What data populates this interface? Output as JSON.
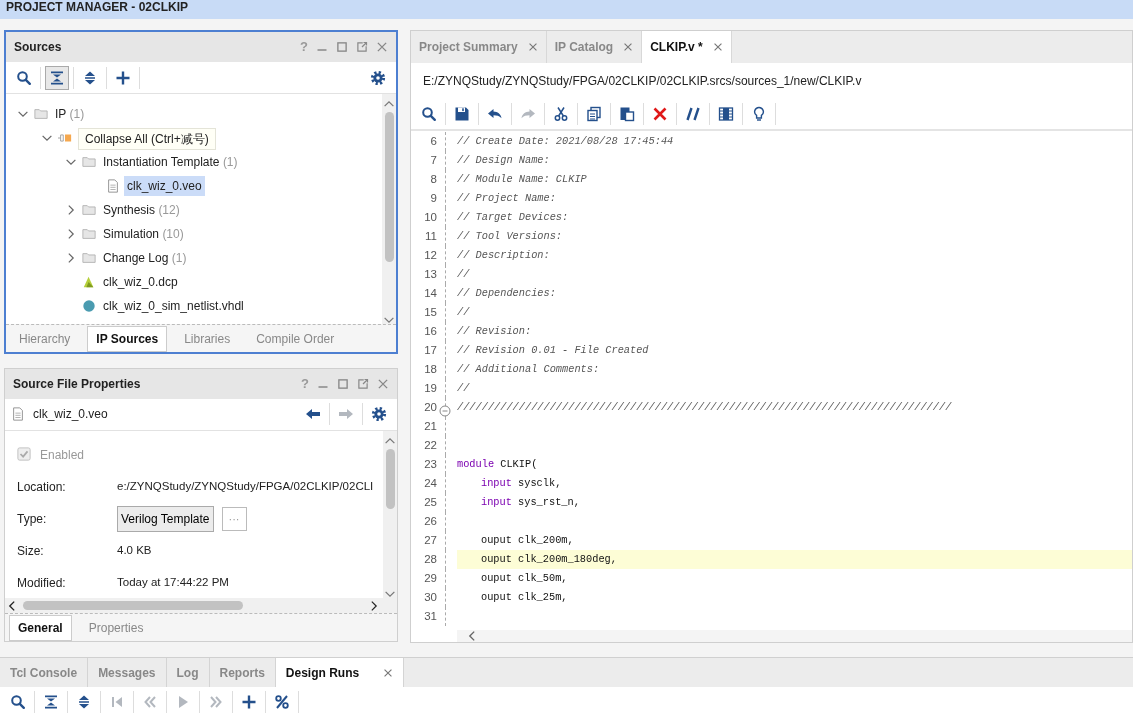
{
  "header": {
    "title": "PROJECT MANAGER - 02CLKIP"
  },
  "sources": {
    "title": "Sources",
    "help": "?",
    "toolbar": [
      {
        "pressed": false
      },
      {
        "pressed": true
      },
      {
        "pressed": false
      },
      {
        "pressed": false
      }
    ],
    "tree": [
      {
        "kind": "folder",
        "label": "IP",
        "count": "(1)",
        "expanded": true,
        "selected": false,
        "children": [
          {
            "kind": "ip",
            "expanded": true,
            "children": [
              {
                "kind": "folder",
                "label": "Instantiation Template",
                "count": "(1)",
                "expanded": true,
                "selected": false,
                "children": [
                  {
                    "kind": "file",
                    "label": "clk_wiz_0.veo",
                    "selected": true
                  }
                ]
              },
              {
                "kind": "folder",
                "label": "Synthesis",
                "count": "(12)",
                "expanded": false,
                "selected": false
              },
              {
                "kind": "folder",
                "label": "Simulation",
                "count": "(10)",
                "expanded": false,
                "selected": false
              },
              {
                "kind": "folder",
                "label": "Change Log",
                "count": "(1)",
                "expanded": false,
                "selected": false
              },
              {
                "kind": "dcp",
                "label": "clk_wiz_0.dcp",
                "selected": false
              },
              {
                "kind": "sim",
                "label": "clk_wiz_0_sim_netlist.vhdl",
                "selected": false
              }
            ]
          }
        ]
      }
    ],
    "tooltip": "Collapse All (Ctrl+减号)",
    "tabs": [
      {
        "label": "Hierarchy",
        "selected": false
      },
      {
        "label": "IP Sources",
        "selected": true
      },
      {
        "label": "Libraries",
        "selected": false
      },
      {
        "label": "Compile Order",
        "selected": false
      }
    ]
  },
  "properties": {
    "title": "Source File Properties",
    "help": "?",
    "file": "clk_wiz_0.veo",
    "nav": [
      {
        "disabled": false
      },
      {
        "disabled": true
      }
    ],
    "enabled": {
      "label": "Enabled",
      "checked": true,
      "disabled": true
    },
    "rows": [
      {
        "kind": "text",
        "label": "Location:",
        "value": "e:/ZYNQStudy/ZYNQStudy/FPGA/02CLKIP/02CLI"
      },
      {
        "kind": "button",
        "label": "Type:",
        "value": "Verilog Template",
        "more": "···"
      },
      {
        "kind": "text",
        "label": "Size:",
        "value": "4.0 KB"
      },
      {
        "kind": "text",
        "label": "Modified:",
        "value": "Today at 17:44:22 PM"
      }
    ],
    "tabs": [
      {
        "label": "General",
        "selected": true
      },
      {
        "label": "Properties",
        "selected": false
      }
    ]
  },
  "editor": {
    "tabs": [
      {
        "label": "Project Summary",
        "selected": false
      },
      {
        "label": "IP Catalog",
        "selected": false
      },
      {
        "label": "CLKIP.v *",
        "selected": true
      }
    ],
    "path": "E:/ZYNQStudy/ZYNQStudy/FPGA/02CLKIP/02CLKIP.srcs/sources_1/new/CLKIP.v",
    "toolbar": [
      {
        "disabled": false
      },
      {
        "disabled": false
      },
      {
        "disabled": false
      },
      {
        "disabled": true
      },
      {
        "disabled": false
      },
      {
        "disabled": false
      },
      {
        "disabled": false
      },
      {
        "disabled": false
      },
      {
        "disabled": false
      },
      {
        "disabled": false
      },
      {
        "disabled": false
      }
    ],
    "lines": [
      {
        "number": "6",
        "kind": "comment",
        "text": "// Create Date: 2021/08/28 17:45:44",
        "current": false,
        "fold": false
      },
      {
        "number": "7",
        "kind": "comment",
        "text": "// Design Name:",
        "current": false,
        "fold": false
      },
      {
        "number": "8",
        "kind": "comment",
        "text": "// Module Name: CLKIP",
        "current": false,
        "fold": false
      },
      {
        "number": "9",
        "kind": "comment",
        "text": "// Project Name:",
        "current": false,
        "fold": false
      },
      {
        "number": "10",
        "kind": "comment",
        "text": "// Target Devices:",
        "current": false,
        "fold": false
      },
      {
        "number": "11",
        "kind": "comment",
        "text": "// Tool Versions:",
        "current": false,
        "fold": false
      },
      {
        "number": "12",
        "kind": "comment",
        "text": "// Description:",
        "current": false,
        "fold": false
      },
      {
        "number": "13",
        "kind": "comment",
        "text": "//",
        "current": false,
        "fold": false
      },
      {
        "number": "14",
        "kind": "comment",
        "text": "// Dependencies:",
        "current": false,
        "fold": false
      },
      {
        "number": "15",
        "kind": "comment",
        "text": "//",
        "current": false,
        "fold": false
      },
      {
        "number": "16",
        "kind": "comment",
        "text": "// Revision:",
        "current": false,
        "fold": false
      },
      {
        "number": "17",
        "kind": "comment",
        "text": "// Revision 0.01 - File Created",
        "current": false,
        "fold": false
      },
      {
        "number": "18",
        "kind": "comment",
        "text": "// Additional Comments:",
        "current": false,
        "fold": false
      },
      {
        "number": "19",
        "kind": "comment",
        "text": "//",
        "current": false,
        "fold": false
      },
      {
        "number": "20",
        "kind": "comment",
        "text": "////////////////////////////////////////////////////////////////////////////////",
        "current": false,
        "fold": true
      },
      {
        "number": "21",
        "kind": "blank",
        "current": false,
        "fold": false
      },
      {
        "number": "22",
        "kind": "blank",
        "current": false,
        "fold": false
      },
      {
        "number": "23",
        "kind": "code",
        "indent": false,
        "keyword": "module",
        "text": " CLKIP(",
        "current": false,
        "fold": false
      },
      {
        "number": "24",
        "kind": "code",
        "indent": true,
        "keyword": "input",
        "text": " sysclk,",
        "current": false,
        "fold": false
      },
      {
        "number": "25",
        "kind": "code",
        "indent": true,
        "keyword": "input",
        "text": " sys_rst_n,",
        "current": false,
        "fold": false
      },
      {
        "number": "26",
        "kind": "blank",
        "current": false,
        "fold": false
      },
      {
        "number": "27",
        "kind": "code",
        "indent": true,
        "text": "ouput clk_200m,",
        "current": false,
        "fold": false
      },
      {
        "number": "28",
        "kind": "code",
        "indent": true,
        "text": "ouput clk_200m_180deg,",
        "current": true,
        "fold": false
      },
      {
        "number": "29",
        "kind": "code",
        "indent": true,
        "text": "ouput clk_50m,",
        "current": false,
        "fold": false
      },
      {
        "number": "30",
        "kind": "code",
        "indent": true,
        "text": "ouput clk_25m,",
        "current": false,
        "fold": false
      },
      {
        "number": "31",
        "kind": "blank",
        "current": false,
        "fold": false
      }
    ]
  },
  "bottom": {
    "tabs": [
      {
        "label": "Tcl Console",
        "selected": false
      },
      {
        "label": "Messages",
        "selected": false
      },
      {
        "label": "Log",
        "selected": false
      },
      {
        "label": "Reports",
        "selected": false
      },
      {
        "label": "Design Runs",
        "selected": true
      }
    ],
    "toolbar": [
      {
        "disabled": false
      },
      {
        "disabled": false
      },
      {
        "disabled": false
      },
      {
        "disabled": true
      },
      {
        "disabled": true
      },
      {
        "disabled": true
      },
      {
        "disabled": true
      },
      {
        "disabled": false
      },
      {
        "disabled": false
      }
    ]
  }
}
